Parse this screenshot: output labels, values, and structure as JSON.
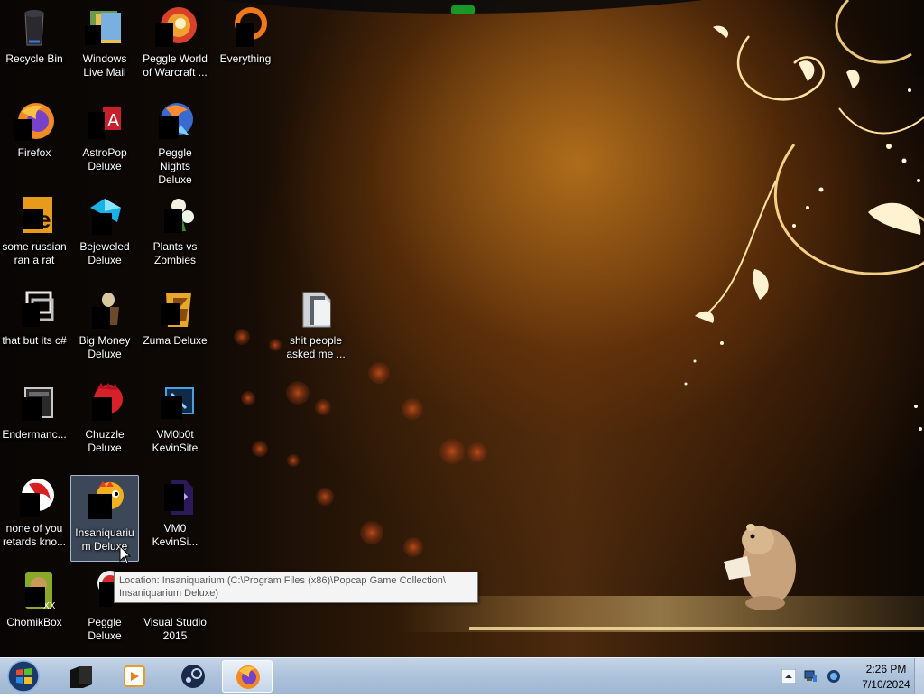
{
  "desktop": {
    "icons": [
      {
        "label": "Recycle Bin",
        "icon": "recycle-bin-icon"
      },
      {
        "label": "Windows Live Mail",
        "icon": "mail-icon"
      },
      {
        "label": "Peggle World of Warcraft ...",
        "icon": "peggle-wow-icon"
      },
      {
        "label": "Everything",
        "icon": "everything-search-icon"
      },
      {
        "label": "Firefox",
        "icon": "firefox-icon"
      },
      {
        "label": "AstroPop Deluxe",
        "icon": "astropop-icon"
      },
      {
        "label": "Peggle Nights Deluxe",
        "icon": "peggle-nights-icon"
      },
      {
        "label": "some russian ran a rat",
        "icon": "shortcut-file-icon"
      },
      {
        "label": "Bejeweled Deluxe",
        "icon": "bejeweled-icon"
      },
      {
        "label": "Plants vs Zombies",
        "icon": "plants-vs-zombies-icon"
      },
      {
        "label": "that but its c#",
        "icon": "shortcut-window-icon"
      },
      {
        "label": "Big Money Deluxe",
        "icon": "big-money-icon"
      },
      {
        "label": "Zuma Deluxe",
        "icon": "zuma-icon"
      },
      {
        "label": "shit people asked me ...",
        "icon": "folder-icon"
      },
      {
        "label": "Endermanc...",
        "icon": "window-app-icon"
      },
      {
        "label": "Chuzzle Deluxe",
        "icon": "chuzzle-icon"
      },
      {
        "label": "VM0b0t KevinSite",
        "icon": "vm-app-icon"
      },
      {
        "label": "none of you retards kno...",
        "icon": "shortcut-red-icon"
      },
      {
        "label": "Insaniquarium Deluxe",
        "icon": "insaniquarium-icon"
      },
      {
        "label": "VM0 KevinSi...",
        "icon": "vm-file-icon"
      },
      {
        "label": "ChomikBox",
        "icon": "chomikbox-icon"
      },
      {
        "label": "Peggle Deluxe",
        "icon": "peggle-icon"
      },
      {
        "label": "Visual Studio 2015",
        "icon": "visual-studio-icon"
      }
    ],
    "tooltip": {
      "line1": "Location: Insaniquarium (C:\\Program Files (x86)\\Popcap Game Collection\\",
      "line2": "Insaniquarium Deluxe)"
    }
  },
  "taskbar": {
    "start": "start-orb-icon",
    "buttons": [
      "terminal-icon",
      "media-player-icon",
      "steam-icon",
      "firefox-icon"
    ],
    "tray_icons": [
      "show-hidden-icons-icon",
      "network-icon",
      "volume-icon"
    ],
    "clock_time": "2:26 PM",
    "clock_date": "7/10/2024"
  },
  "colors": {
    "taskbar": "#aec3dc",
    "selection": "#7896be",
    "wallpaper_glow": "#f5c060"
  }
}
